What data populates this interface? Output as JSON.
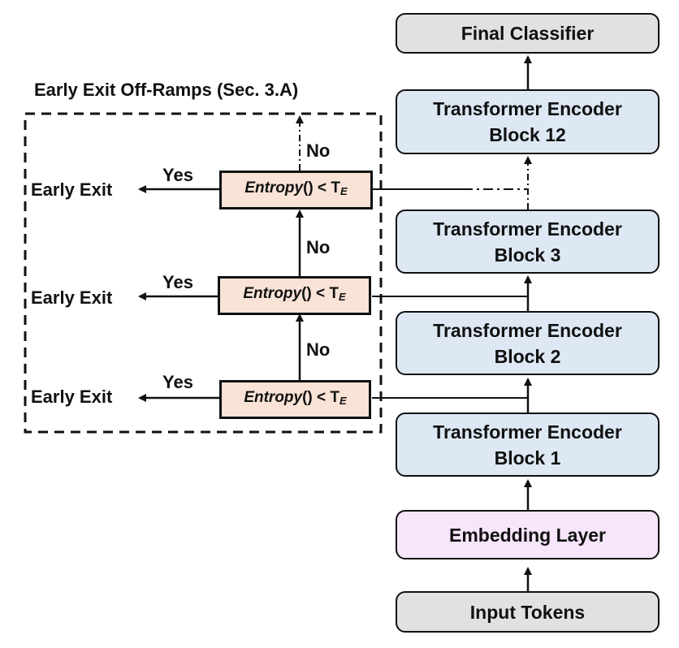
{
  "diagram": {
    "group_title": "Early Exit Off-Ramps (Sec. 3.A)",
    "main_stack": {
      "final_classifier": "Final Classifier",
      "block12": {
        "line1": "Transformer Encoder",
        "line2": "Block 12"
      },
      "block3": {
        "line1": "Transformer Encoder",
        "line2": "Block 3"
      },
      "block2": {
        "line1": "Transformer Encoder",
        "line2": "Block 2"
      },
      "block1": {
        "line1": "Transformer Encoder",
        "line2": "Block 1"
      },
      "embedding": "Embedding Layer",
      "input": "Input Tokens"
    },
    "offramps": [
      {
        "func": "Entropy",
        "expr": "() < T",
        "sub": "E",
        "yes": "Yes",
        "no": "No",
        "exit": "Early Exit"
      },
      {
        "func": "Entropy",
        "expr": "() < T",
        "sub": "E",
        "yes": "Yes",
        "no": "No",
        "exit": "Early Exit"
      },
      {
        "func": "Entropy",
        "expr": "() < T",
        "sub": "E",
        "yes": "Yes",
        "no": "No",
        "exit": "Early Exit"
      }
    ],
    "colors": {
      "terminal_fill": "#e1e1e1",
      "encoder_fill": "#dde8f4",
      "embedding_fill": "#f7e5fb",
      "check_fill": "#f8e3d6",
      "stroke": "#111111"
    }
  }
}
